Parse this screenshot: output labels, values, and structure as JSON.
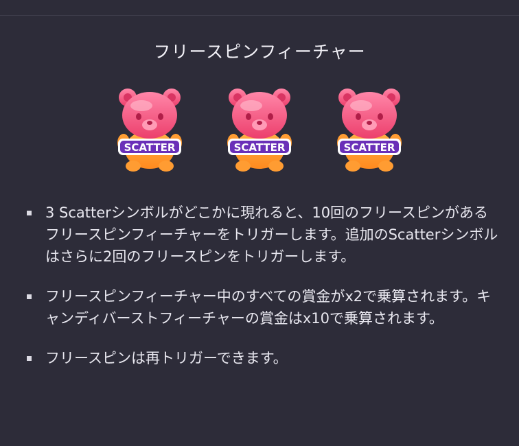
{
  "feature": {
    "title": "フリースピンフィーチャー",
    "symbol_label": "SCATTER",
    "symbol_count": 3
  },
  "rules": [
    "3 Scatterシンボルがどこかに現れると、10回のフリースピンがあるフリースピンフィーチャーをトリガーします。追加のScatterシンボルはさらに2回のフリースピンをトリガーします。",
    "フリースピンフィーチャー中のすべての賞金がx2で乗算されます。キャンディバーストフィーチャーの賞金はx10で乗算されます。",
    "フリースピンは再トリガーできます。"
  ],
  "colors": {
    "background": "#2d2c39",
    "bear_pink": "#f4537c",
    "bear_orange": "#ff9a2e",
    "label_purple": "#6a2fb8"
  }
}
